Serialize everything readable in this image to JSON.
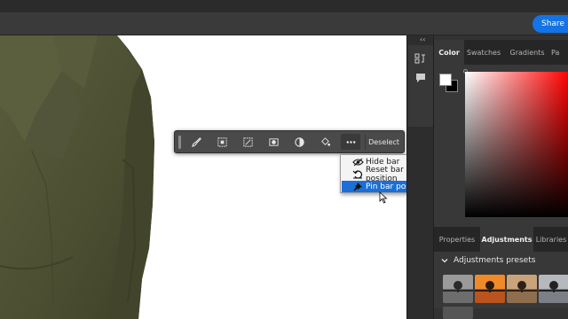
{
  "header": {
    "share_label": "Share"
  },
  "taskbar": {
    "buttons": [
      {
        "name": "brush-selection-icon"
      },
      {
        "name": "select-subject-icon"
      },
      {
        "name": "transform-selection-icon"
      },
      {
        "name": "create-mask-icon"
      },
      {
        "name": "adjustment-layer-icon"
      },
      {
        "name": "fill-selection-icon"
      },
      {
        "name": "more-options-icon"
      }
    ],
    "deselect_label": "Deselect"
  },
  "more_menu": {
    "items": [
      {
        "label": "Hide bar",
        "icon": "eye-hidden-icon",
        "selected": false
      },
      {
        "label": "Reset bar position",
        "icon": "reset-icon",
        "selected": false
      },
      {
        "label": "Pin bar position",
        "icon": "pin-icon",
        "selected": true
      }
    ]
  },
  "color_panel": {
    "tabs": [
      "Color",
      "Swatches",
      "Gradients",
      "Pa"
    ],
    "active_tab": "Color",
    "foreground_color": "#ffffff",
    "background_color": "#000000",
    "hue_color": "#ff0000"
  },
  "adjustments_panel": {
    "tabs": [
      "Properties",
      "Adjustments",
      "Libraries"
    ],
    "active_tab": "Adjustments",
    "section_title": "Adjustments presets"
  },
  "colors": {
    "accent": "#1473e6",
    "menu_selected": "#1c6fd6",
    "jacket": "#4f5235"
  }
}
